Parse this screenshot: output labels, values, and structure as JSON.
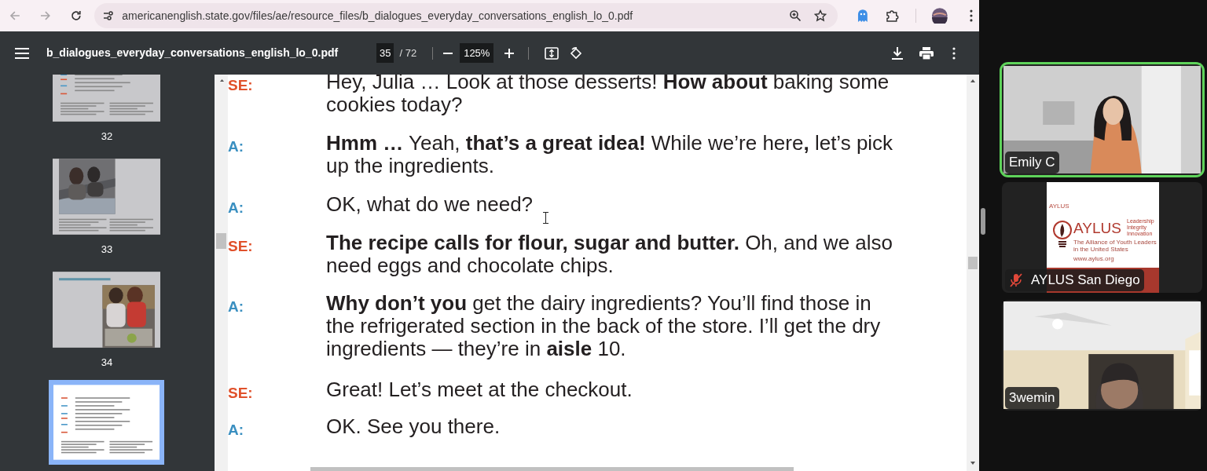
{
  "browser": {
    "url": "americanenglish.state.gov/files/ae/resource_files/b_dialogues_everyday_conversations_english_lo_0.pdf"
  },
  "pdf_toolbar": {
    "title": "b_dialogues_everyday_conversations_english_lo_0.pdf",
    "page_number": "35",
    "page_total": "/ 72",
    "zoom": "125%"
  },
  "thumbnails": [
    {
      "kind": "text",
      "label": "32",
      "selected": false
    },
    {
      "label": "33",
      "selected": false
    },
    {
      "kind": "photo_heading",
      "label": "34",
      "selected": false
    },
    {
      "kind": "text",
      "selected": true
    }
  ],
  "dialogue": [
    {
      "speaker": "SE:",
      "color": "#e0512b",
      "text": "Hey, Julia … Look at those desserts! **How about** baking some cookies today?"
    },
    {
      "speaker": "A:",
      "color": "#3a8fc0",
      "text": "**Hmm …** Yeah, **that’s a great idea!** While we’re here**,** let’s pick up the ingredients."
    },
    {
      "speaker": "A:",
      "color": "#3a8fc0",
      "text": "OK, what do we need?"
    },
    {
      "speaker": "SE:",
      "color": "#e0512b",
      "text": "**The recipe calls for flour, sugar and butter.** Oh, and we also need eggs and chocolate chips."
    },
    {
      "speaker": "A:",
      "color": "#3a8fc0",
      "text": "**Why don’t you** get the dairy ingredients? You’ll find those in the refrigerated section in the back of the store. I’ll get the dry ingredients — they’re in **aisle** 10."
    },
    {
      "speaker": "SE:",
      "color": "#e0512b",
      "text": "Great! Let’s meet at the checkout."
    },
    {
      "speaker": "A:",
      "color": "#3a8fc0",
      "text": "OK. See you there."
    }
  ],
  "participants": [
    {
      "kind": "camera",
      "name": "Emily C",
      "speaking": true,
      "muted": false
    },
    {
      "kind": "slide",
      "name": "AYLUS San Diego",
      "speaking": false,
      "muted": true,
      "slide": {
        "header": "AYLUS",
        "logo": "AYLUS",
        "motto": [
          "Leadership",
          "Integrity",
          "Innovation"
        ],
        "full_name": "The Alliance of Youth Leaders in the United States",
        "website": "www.aylus.org"
      }
    },
    {
      "kind": "camera_room",
      "name": "3wemin",
      "speaking": false,
      "muted": false
    }
  ]
}
